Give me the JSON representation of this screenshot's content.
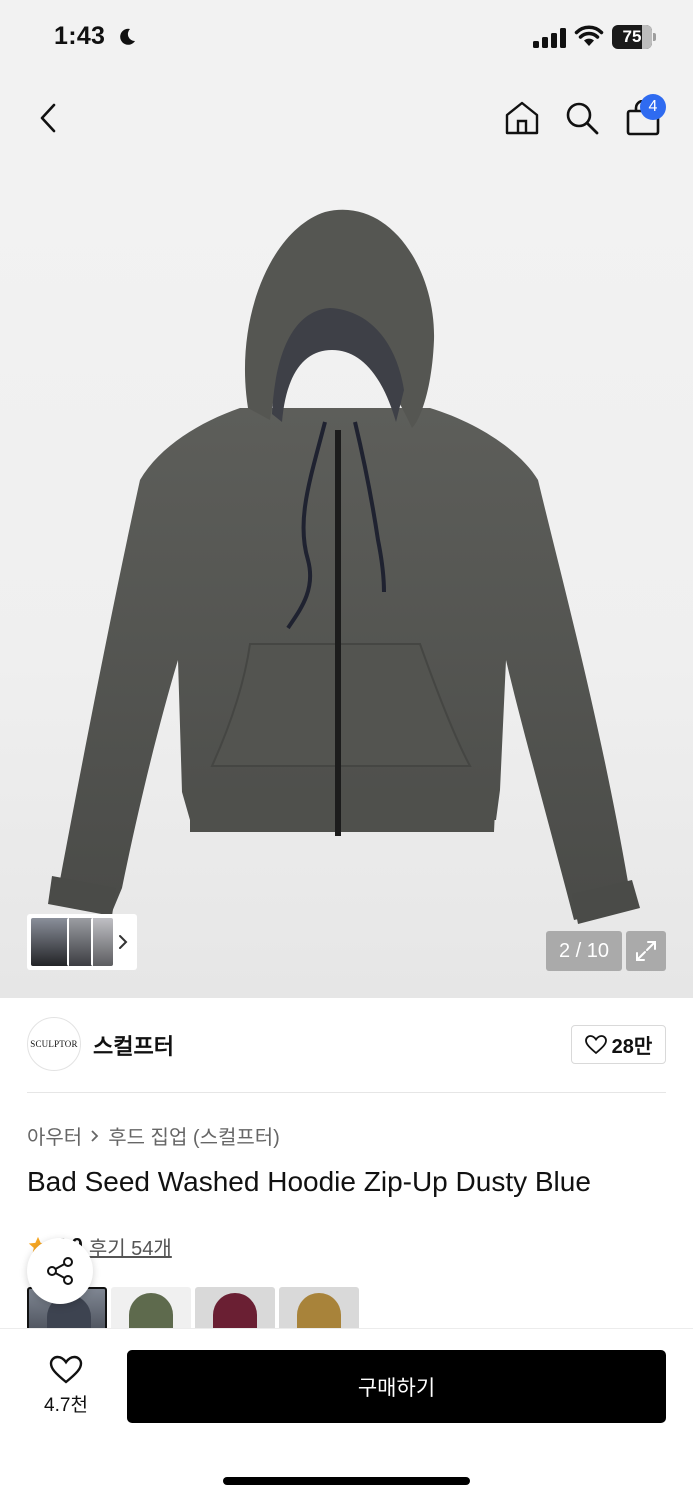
{
  "status_bar": {
    "time": "1:43",
    "battery_level": "75",
    "battery_fraction": 0.75
  },
  "nav": {
    "back_icon": "chevron-left-icon",
    "home_icon": "home-icon",
    "search_icon": "search-icon",
    "cart_icon": "shopping-bag-icon",
    "cart_badge": "4",
    "badge_color": "#2f6bf0"
  },
  "gallery": {
    "page_counter": "2 / 10",
    "expand_icon": "expand-icon"
  },
  "brand": {
    "logo_text": "SCULPTOR",
    "name": "스컬프터",
    "like_count": "28만"
  },
  "product": {
    "breadcrumb": [
      "아우터",
      "후드 집업 (스컬프터)"
    ],
    "title": "Bad Seed Washed Hoodie Zip-Up Dusty Blue",
    "rating": "4.9",
    "reviews": "후기 54개",
    "star_color": "#f5a623"
  },
  "bottom_bar": {
    "wish_count": "4.7천",
    "buy_label": "구매하기"
  }
}
